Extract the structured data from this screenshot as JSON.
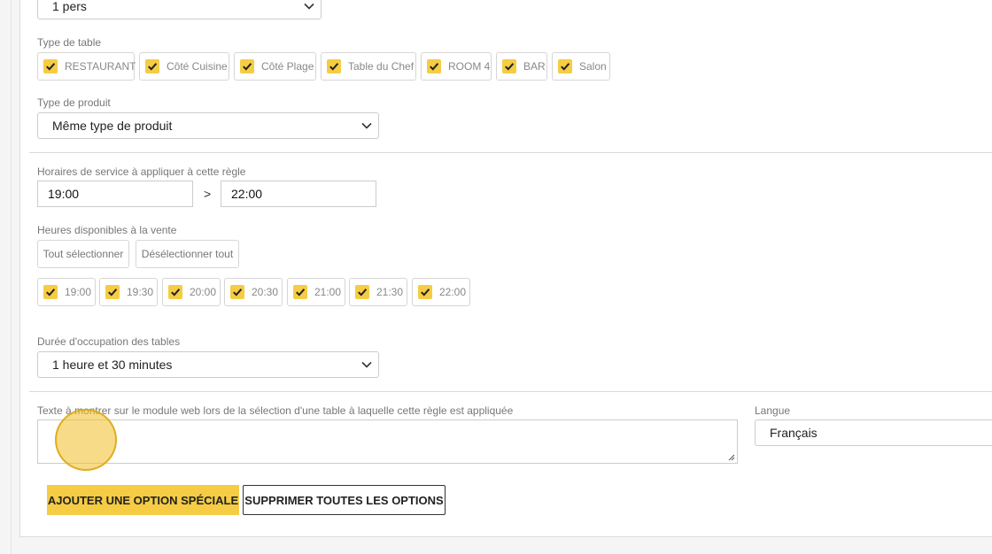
{
  "colors": {
    "accent": "#f5cc44",
    "border": "#cccccc",
    "label": "#777777"
  },
  "persons_select": {
    "value": "1 pers",
    "icon": "chevron-down-icon"
  },
  "table_type": {
    "label": "Type de table",
    "options": [
      {
        "label": "RESTAURANT",
        "checked": true
      },
      {
        "label": "Côté Cuisine",
        "checked": true
      },
      {
        "label": "Côté Plage",
        "checked": true
      },
      {
        "label": "Table du Chef",
        "checked": true
      },
      {
        "label": "ROOM 4",
        "checked": true
      },
      {
        "label": "BAR",
        "checked": true
      },
      {
        "label": "Salon",
        "checked": true
      }
    ]
  },
  "product_type": {
    "label": "Type de produit",
    "value": "Même type de produit"
  },
  "service_hours": {
    "label": "Horaires de service à appliquer à cette règle",
    "start": "19:00",
    "separator": ">",
    "end": "22:00"
  },
  "available_hours": {
    "label": "Heures disponibles à la vente",
    "select_all": "Tout sélectionner",
    "deselect_all": "Désélectionner tout",
    "slots": [
      {
        "label": "19:00",
        "checked": true
      },
      {
        "label": "19:30",
        "checked": true
      },
      {
        "label": "20:00",
        "checked": true
      },
      {
        "label": "20:30",
        "checked": true
      },
      {
        "label": "21:00",
        "checked": true
      },
      {
        "label": "21:30",
        "checked": true
      },
      {
        "label": "22:00",
        "checked": true
      }
    ]
  },
  "duration": {
    "label": "Durée d'occupation des tables",
    "value": "1 heure et 30 minutes"
  },
  "web_text": {
    "label": "Texte à montrer sur le module web lors de la sélection d'une table à laquelle cette règle est appliquée",
    "value": ""
  },
  "language": {
    "label": "Langue",
    "value": "Français"
  },
  "actions": {
    "add_special": "AJOUTER UNE OPTION SPÉCIALE",
    "remove_all": "SUPPRIMER TOUTES LES OPTIONS"
  }
}
